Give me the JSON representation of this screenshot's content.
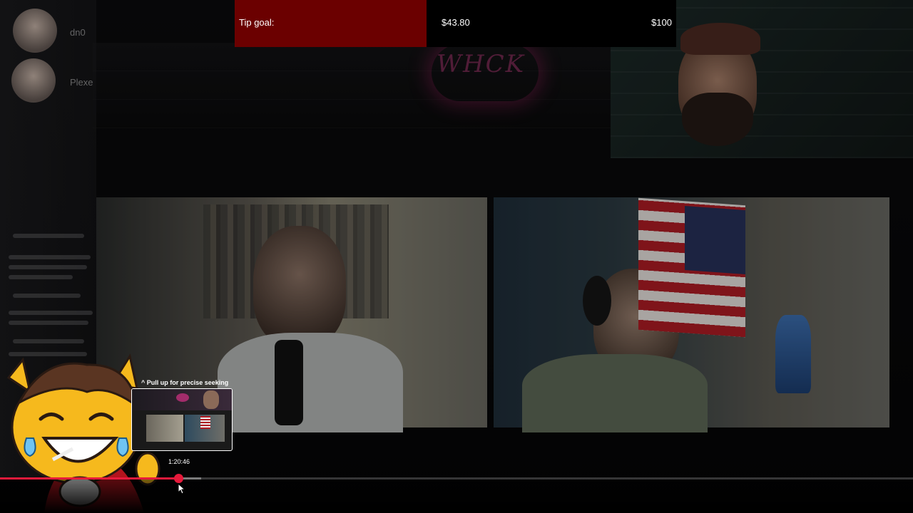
{
  "tip_goal": {
    "label": "Tip goal:",
    "current": "$43.80",
    "target": "$100",
    "progress_fraction": 0.438,
    "fill_color": "#6b0000"
  },
  "chat": {
    "users": [
      "dn0",
      "Plexe"
    ]
  },
  "seek_preview": {
    "hint": "^ Pull up for precise seeking",
    "time": "1:20:46"
  },
  "player": {
    "played_fraction": 0.195,
    "buffered_fraction": 0.22,
    "accent_color": "#e61a3b"
  }
}
